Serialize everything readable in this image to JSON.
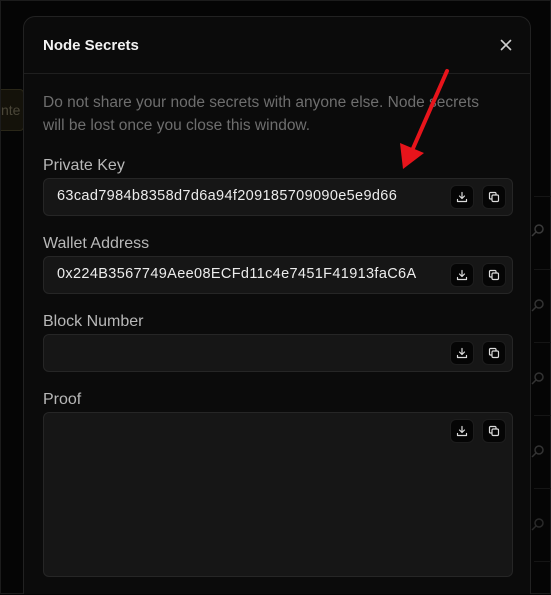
{
  "background": {
    "partial_input_text": "nte"
  },
  "modal": {
    "title": "Node Secrets",
    "warning": "Do not share your node secrets with anyone else. Node secrets will be lost once you close this window.",
    "fields": [
      {
        "label": "Private Key",
        "value": "63cad7984b8358d7d6a94f209185709090e5e9d66"
      },
      {
        "label": "Wallet Address",
        "value": "0x224B3567749Aee08ECFd11c4e7451F41913faC6A"
      },
      {
        "label": "Block Number",
        "value": ""
      },
      {
        "label": "Proof",
        "value": ""
      }
    ]
  },
  "colors": {
    "annotation_arrow": "#e8141b",
    "modal_bg": "#0b0b0b",
    "field_bg": "#161616"
  },
  "icons": [
    "close-icon",
    "download-icon",
    "copy-icon",
    "search-icon",
    "arrow-annotation"
  ]
}
